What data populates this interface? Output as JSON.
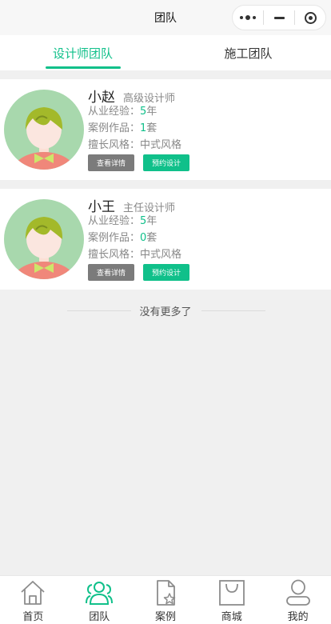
{
  "navbar": {
    "title": "团队"
  },
  "tabs": [
    {
      "label": "设计师团队",
      "active": true
    },
    {
      "label": "施工团队",
      "active": false
    }
  ],
  "designers": [
    {
      "name": "小赵",
      "title": "高级设计师",
      "exp_label": "从业经验：",
      "exp_value": "5",
      "exp_unit": "年",
      "cases_label": "案例作品：",
      "cases_value": "1",
      "cases_unit": "套",
      "style_label": "擅长风格：",
      "style_value": "中式风格",
      "detail_btn": "查看详情",
      "book_btn": "预约设计"
    },
    {
      "name": "小王",
      "title": "主任设计师",
      "exp_label": "从业经验：",
      "exp_value": "5",
      "exp_unit": "年",
      "cases_label": "案例作品：",
      "cases_value": "0",
      "cases_unit": "套",
      "style_label": "擅长风格：",
      "style_value": "中式风格",
      "detail_btn": "查看详情",
      "book_btn": "预约设计"
    }
  ],
  "no_more": "没有更多了",
  "tabbar": [
    {
      "label": "首页",
      "icon": "home-icon",
      "active": false
    },
    {
      "label": "团队",
      "icon": "team-icon",
      "active": true
    },
    {
      "label": "案例",
      "icon": "case-icon",
      "active": false
    },
    {
      "label": "商城",
      "icon": "shop-icon",
      "active": false
    },
    {
      "label": "我的",
      "icon": "user-icon",
      "active": false
    }
  ],
  "colors": {
    "accent": "#10c08a",
    "detail_button": "#7b7b7b",
    "background": "#f0f0f0"
  }
}
